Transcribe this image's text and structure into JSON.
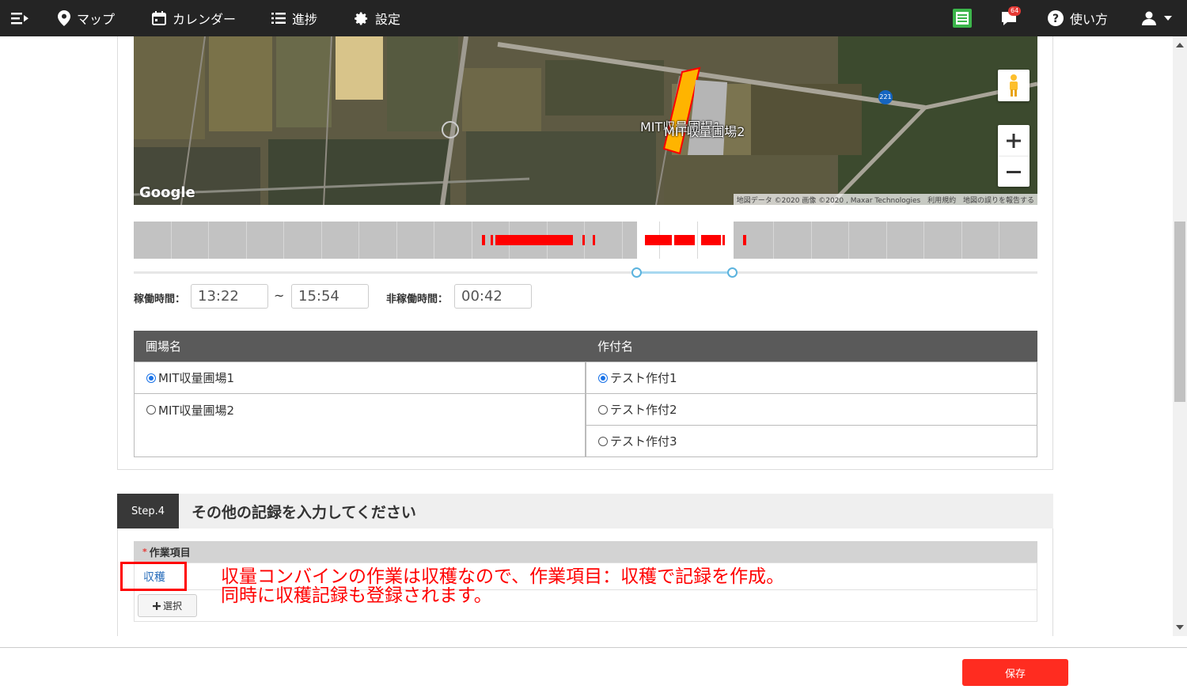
{
  "nav": {
    "map": "マップ",
    "calendar": "カレンダー",
    "progress": "進捗",
    "settings": "設定",
    "notification_count": "64",
    "help": "使い方"
  },
  "map": {
    "field_label_1": "MIT収量圃場1",
    "field_label_2": "MIT収量圃場2",
    "road_number": "221",
    "google_logo": "Google",
    "footer_text": "地図データ ©2020 画像 ©2020 , Maxar Technologies",
    "terms": "利用規約",
    "report": "地図の誤りを報告する"
  },
  "times": {
    "operating_label": "稼働時間：",
    "start": "13:22",
    "tilde": "~",
    "end": "15:54",
    "idle_label": "非稼働時間：",
    "idle": "00:42"
  },
  "table": {
    "col_field": "圃場名",
    "col_crop": "作付名",
    "fields": [
      {
        "label": "MIT収量圃場1",
        "selected": true
      },
      {
        "label": "MIT収量圃場2",
        "selected": false
      }
    ],
    "crops": [
      {
        "label": "テスト作付1",
        "selected": true
      },
      {
        "label": "テスト作付2",
        "selected": false
      },
      {
        "label": "テスト作付3",
        "selected": false
      }
    ]
  },
  "step4": {
    "tag": "Step.4",
    "title": "その他の記録を入力してください",
    "required_mark": "*",
    "work_item_label": "作業項目",
    "work_item_value": "収穫",
    "select_button": "選択",
    "note_line1": "収量コンバインの作業は収穫なので、作業項目：収穫で記録を作成。",
    "note_line2": "同時に収穫記録も登録されます。"
  },
  "footer": {
    "save": "保存"
  },
  "colors": {
    "accent_red": "#ff2c20",
    "link_blue": "#2a6ebb",
    "header_dark": "#242424"
  }
}
